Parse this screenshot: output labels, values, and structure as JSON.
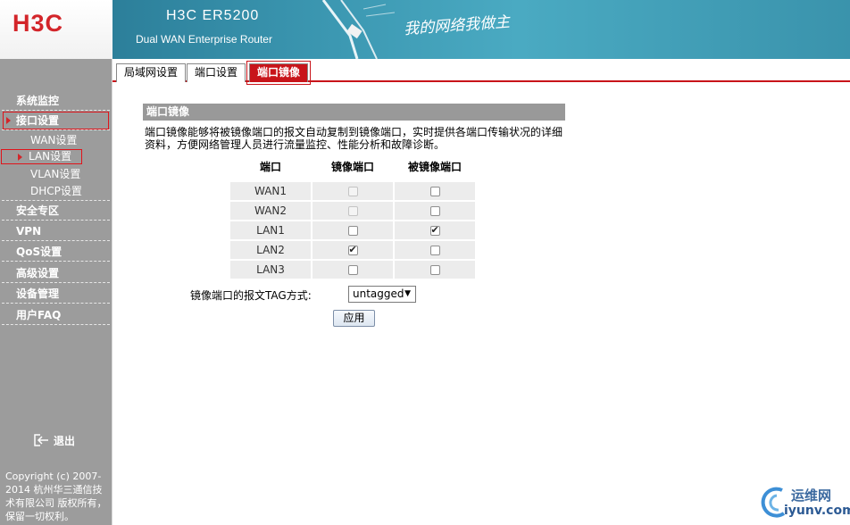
{
  "header": {
    "logo": "H3C",
    "product_name": "H3C ER5200",
    "product_sub": "Dual WAN Enterprise Router",
    "slogan": "我的网络我做主"
  },
  "sidebar": {
    "items": [
      {
        "label": "系统监控"
      },
      {
        "label": "接口设置"
      },
      {
        "label": "WAN设置"
      },
      {
        "label": "LAN设置"
      },
      {
        "label": "VLAN设置"
      },
      {
        "label": "DHCP设置"
      },
      {
        "label": "安全专区"
      },
      {
        "label": "VPN"
      },
      {
        "label": "QoS设置"
      },
      {
        "label": "高级设置"
      },
      {
        "label": "设备管理"
      },
      {
        "label": "用户FAQ"
      }
    ],
    "logout": "退出",
    "copyright": "Copyright (c) 2007-2014 杭州华三通信技术有限公司 版权所有，保留一切权利。"
  },
  "tabs": [
    {
      "label": "局域网设置",
      "active": false
    },
    {
      "label": "端口设置",
      "active": false
    },
    {
      "label": "端口镜像",
      "active": true
    }
  ],
  "section": {
    "title": "端口镜像",
    "description": "端口镜像能够将被镜像端口的报文自动复制到镜像端口，实时提供各端口传输状况的详细资料，方便网络管理人员进行流量监控、性能分析和故障诊断。"
  },
  "table": {
    "headers": [
      "端口",
      "镜像端口",
      "被镜像端口"
    ],
    "rows": [
      {
        "port": "WAN1",
        "mirror": false,
        "mirror_disabled": true,
        "mirrored": false
      },
      {
        "port": "WAN2",
        "mirror": false,
        "mirror_disabled": true,
        "mirrored": false
      },
      {
        "port": "LAN1",
        "mirror": false,
        "mirror_disabled": false,
        "mirrored": true
      },
      {
        "port": "LAN2",
        "mirror": true,
        "mirror_disabled": false,
        "mirrored": false
      },
      {
        "port": "LAN3",
        "mirror": false,
        "mirror_disabled": false,
        "mirrored": false
      }
    ]
  },
  "tag_mode": {
    "label": "镜像端口的报文TAG方式:",
    "value": "untagged"
  },
  "apply_label": "应用",
  "watermark": {
    "line1": "运维网",
    "line2": "iyunv.com"
  },
  "colors": {
    "brand_red": "#c8141a",
    "banner_teal": "#3c98b2",
    "sidebar_gray": "#9c9c9c"
  }
}
